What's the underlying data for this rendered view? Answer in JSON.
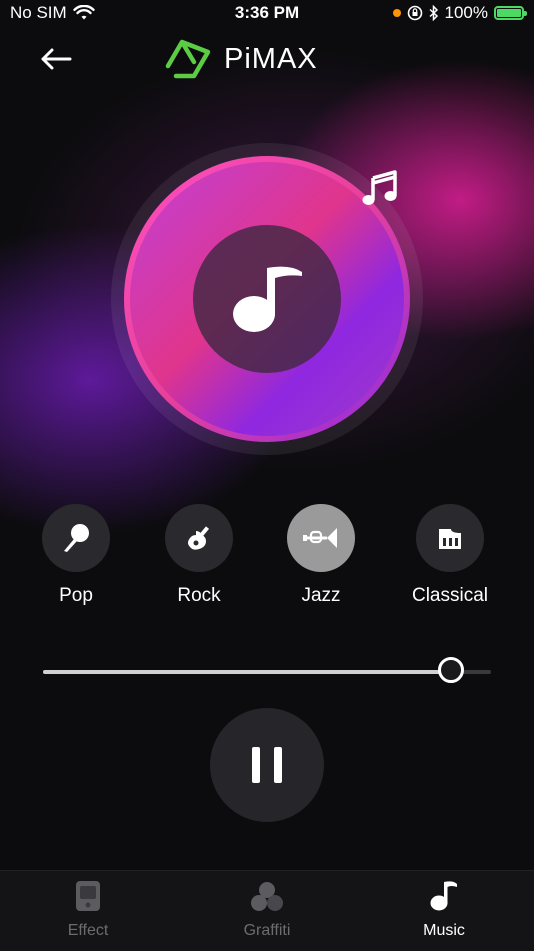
{
  "status_bar": {
    "carrier": "No SIM",
    "time": "3:36 PM",
    "battery": "100%",
    "battery_level": 1.0
  },
  "header": {
    "back_icon": "arrow-left-icon",
    "logo_text": "PiMAX",
    "logo_color": "#5dcc45"
  },
  "player": {
    "disc_icon": "music-note-icon",
    "floating_icon": "music-notes-icon",
    "volume_level": 0.91
  },
  "genres": [
    {
      "label": "Pop",
      "icon": "microphone-icon",
      "active": false
    },
    {
      "label": "Rock",
      "icon": "guitar-icon",
      "active": false
    },
    {
      "label": "Jazz",
      "icon": "trumpet-icon",
      "active": true
    },
    {
      "label": "Classical",
      "icon": "piano-icon",
      "active": false
    }
  ],
  "controls": {
    "pause_icon": "pause-icon"
  },
  "tabs": [
    {
      "label": "Effect",
      "icon": "effect-device-icon",
      "active": false
    },
    {
      "label": "Graffiti",
      "icon": "graffiti-circles-icon",
      "active": false
    },
    {
      "label": "Music",
      "icon": "music-note-icon",
      "active": true
    }
  ],
  "colors": {
    "accent_pink": "#e8409b",
    "accent_purple": "#8a2be2",
    "active_genre": "#9a9a9a"
  }
}
